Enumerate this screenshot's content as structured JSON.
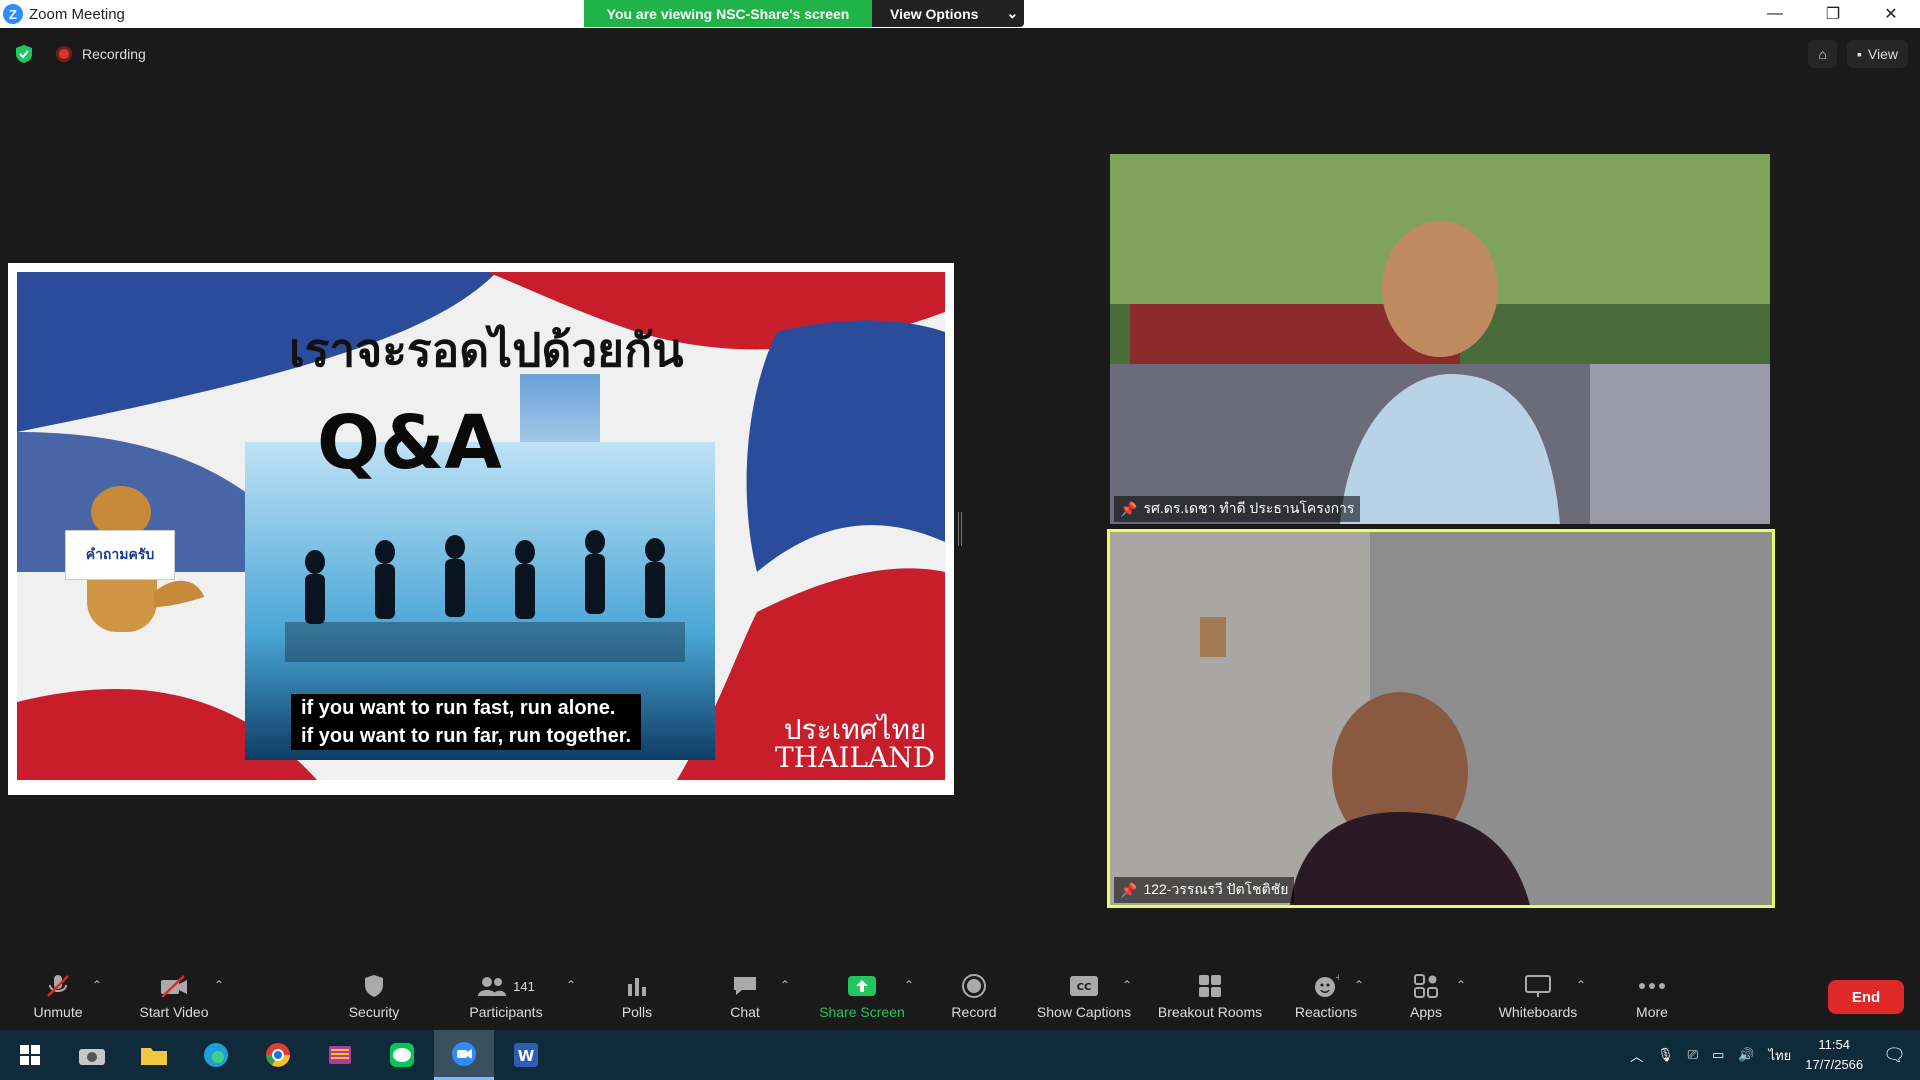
{
  "window": {
    "title": "Zoom Meeting",
    "banner": "You are viewing NSC-Share's screen",
    "view_options": "View Options"
  },
  "meeting_bar": {
    "recording": "Recording",
    "view_label": "View"
  },
  "slide": {
    "title": "เราจะรอดไปด้วยกัน",
    "qa": "Q&A",
    "sign": "คำถามครับ",
    "quote_line1": "if you want to run fast, run alone.",
    "quote_line2": "if you want to run far, run together.",
    "thai_name": "ประเทศไทย",
    "english_name": "THAILAND"
  },
  "participants": [
    {
      "name": "รศ.ดร.เดชา ทำดี ประธานโครงการ"
    },
    {
      "name": "122-วรรณรวี ปัตโชติชัย"
    }
  ],
  "toolbar": {
    "unmute": "Unmute",
    "start_video": "Start Video",
    "security": "Security",
    "participants": "Participants",
    "participant_count": "141",
    "polls": "Polls",
    "chat": "Chat",
    "share_screen": "Share Screen",
    "record": "Record",
    "show_captions": "Show Captions",
    "breakout_rooms": "Breakout Rooms",
    "reactions": "Reactions",
    "apps": "Apps",
    "whiteboards": "Whiteboards",
    "more": "More",
    "end": "End"
  },
  "taskbar": {
    "language": "ไทย",
    "time": "11:54",
    "date": "17/7/2566"
  },
  "colors": {
    "banner_green": "#1fb34a",
    "end_red": "#e02828",
    "share_green": "#23c55e",
    "active_speaker": "#e8ff5a"
  }
}
